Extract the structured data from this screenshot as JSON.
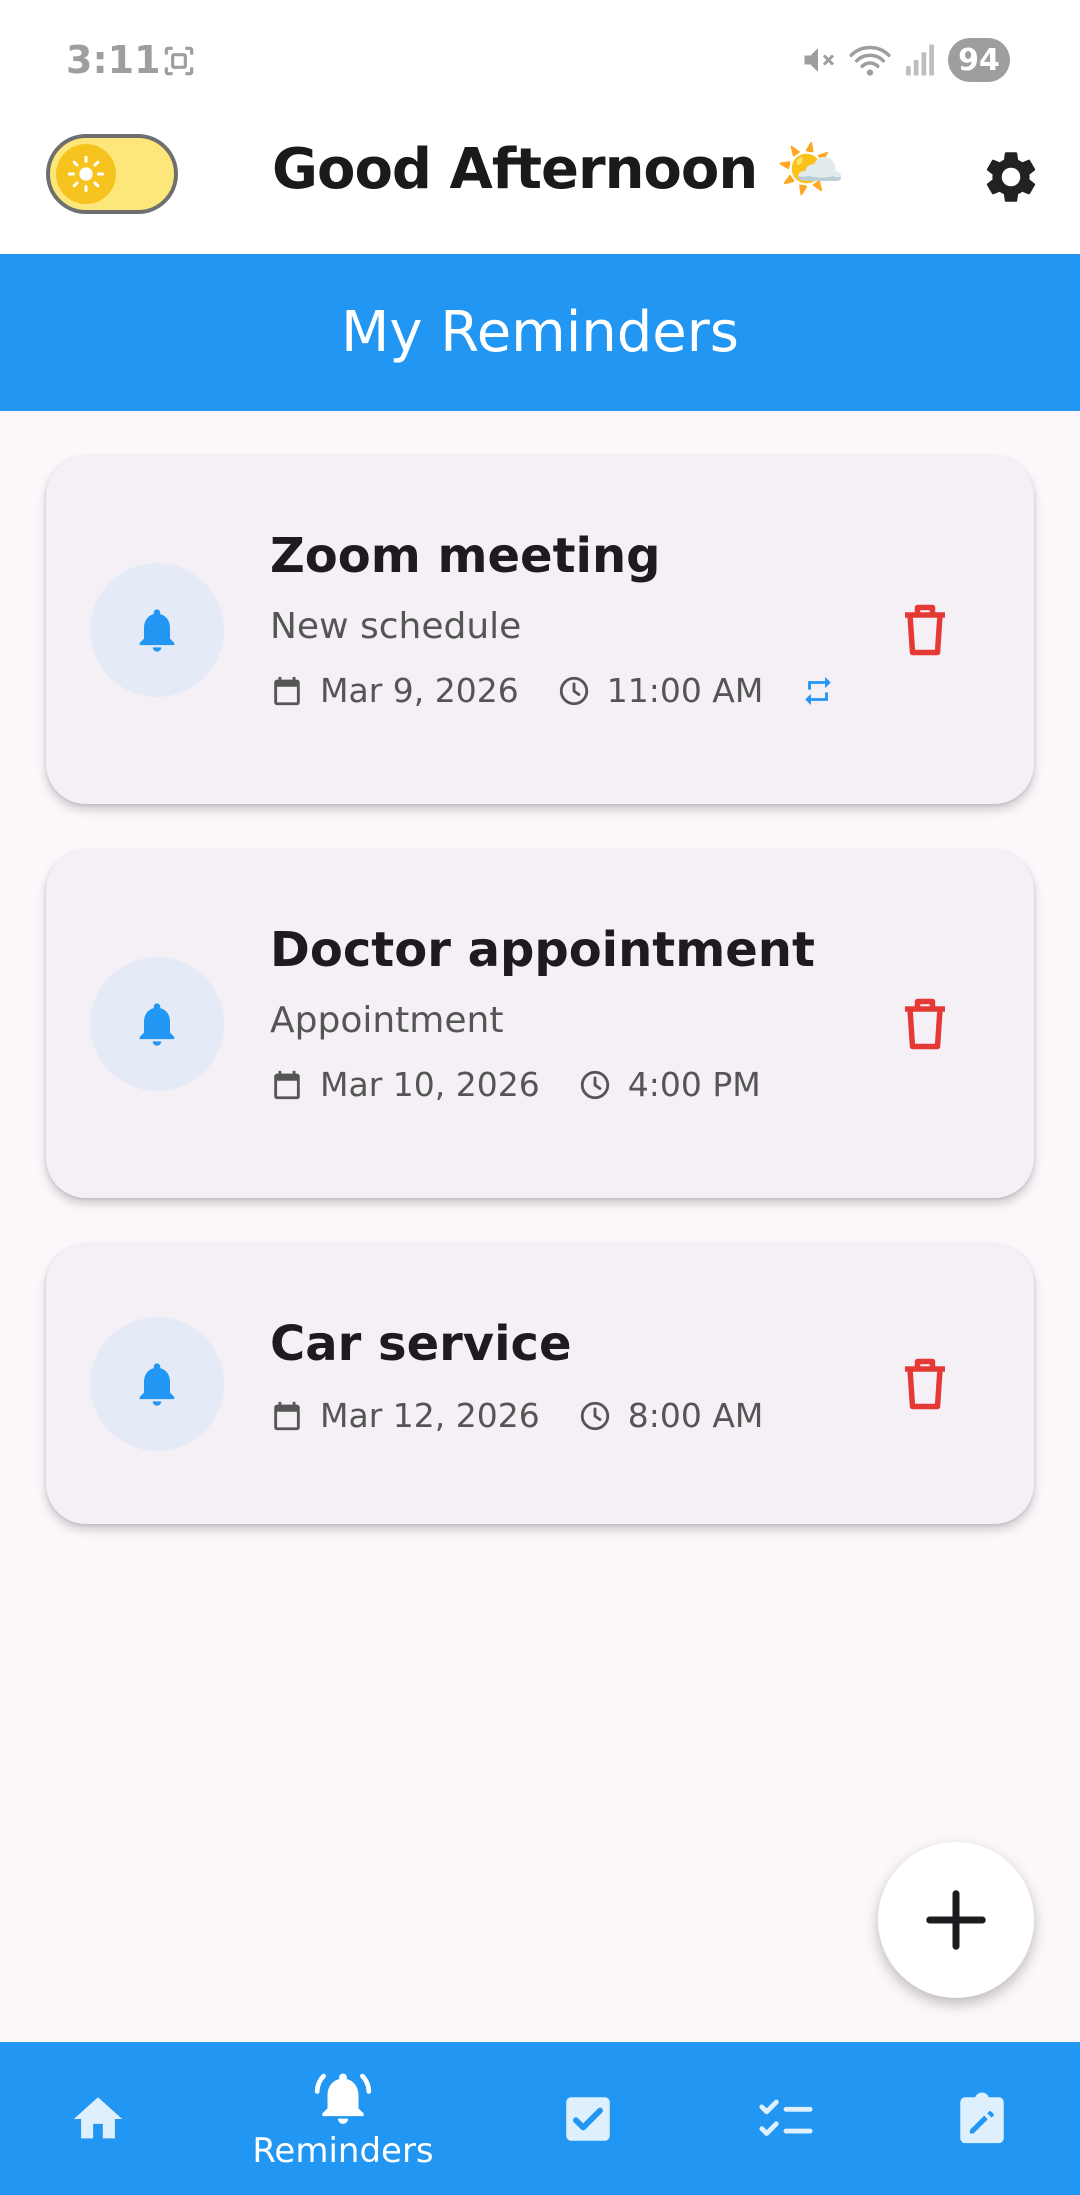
{
  "status_bar": {
    "time": "3:11",
    "battery": "94",
    "icons": [
      "screenshot-icon",
      "mute-icon",
      "wifi-icon",
      "signal-icon"
    ]
  },
  "header": {
    "greeting": "Good Afternoon 🌤️",
    "theme_toggle": "light",
    "settings_icon": "gear-icon"
  },
  "title": "My Reminders",
  "colors": {
    "primary": "#2196f3",
    "delete": "#e53935",
    "card_bg": "#f5f0f6"
  },
  "reminders": [
    {
      "title": "Zoom meeting",
      "subtitle": "New schedule",
      "date": "Mar 9, 2026",
      "time": "11:00 AM",
      "repeat": true
    },
    {
      "title": "Doctor appointment",
      "subtitle": "Appointment",
      "date": "Mar 10, 2026",
      "time": "4:00 PM",
      "repeat": false
    },
    {
      "title": "Car service",
      "subtitle": "",
      "date": "Mar 12, 2026",
      "time": "8:00 AM",
      "repeat": false
    }
  ],
  "fab_icon": "plus-icon",
  "bottom_nav": {
    "items": [
      {
        "icon": "home-icon",
        "label": ""
      },
      {
        "icon": "bell-ring-icon",
        "label": "Reminders",
        "active": true
      },
      {
        "icon": "checkbox-icon",
        "label": ""
      },
      {
        "icon": "checklist-icon",
        "label": ""
      },
      {
        "icon": "edit-note-icon",
        "label": ""
      }
    ]
  }
}
